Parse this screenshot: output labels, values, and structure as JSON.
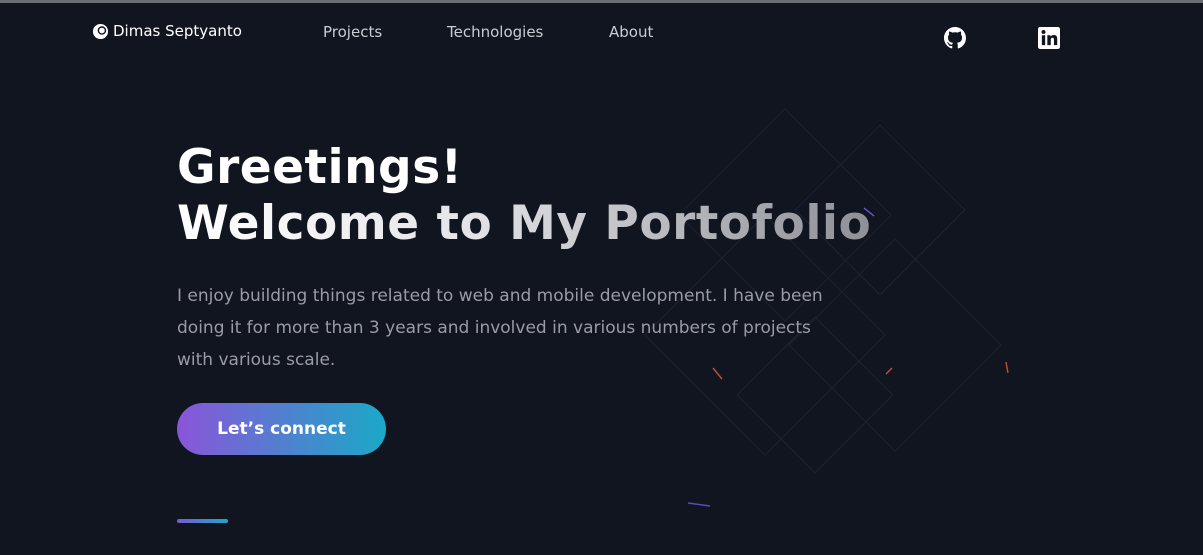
{
  "nav": {
    "brand": "Dimas Septyanto",
    "links": [
      {
        "label": "Projects"
      },
      {
        "label": "Technologies"
      },
      {
        "label": "About"
      }
    ],
    "social": [
      {
        "icon": "github-icon"
      },
      {
        "icon": "linkedin-icon"
      }
    ]
  },
  "hero": {
    "title_line1": "Greetings!",
    "title_line2": "Welcome to My Portofolio",
    "description": "I enjoy building things related to web and mobile development. I have been doing it for more than 3 years and involved in various numbers of projects with various scale.",
    "cta_label": "Let’s connect"
  },
  "colors": {
    "background": "#111520",
    "gradient_start": "#8a55d9",
    "gradient_end": "#1aa9c7",
    "text_muted": "#9a9ca4"
  }
}
